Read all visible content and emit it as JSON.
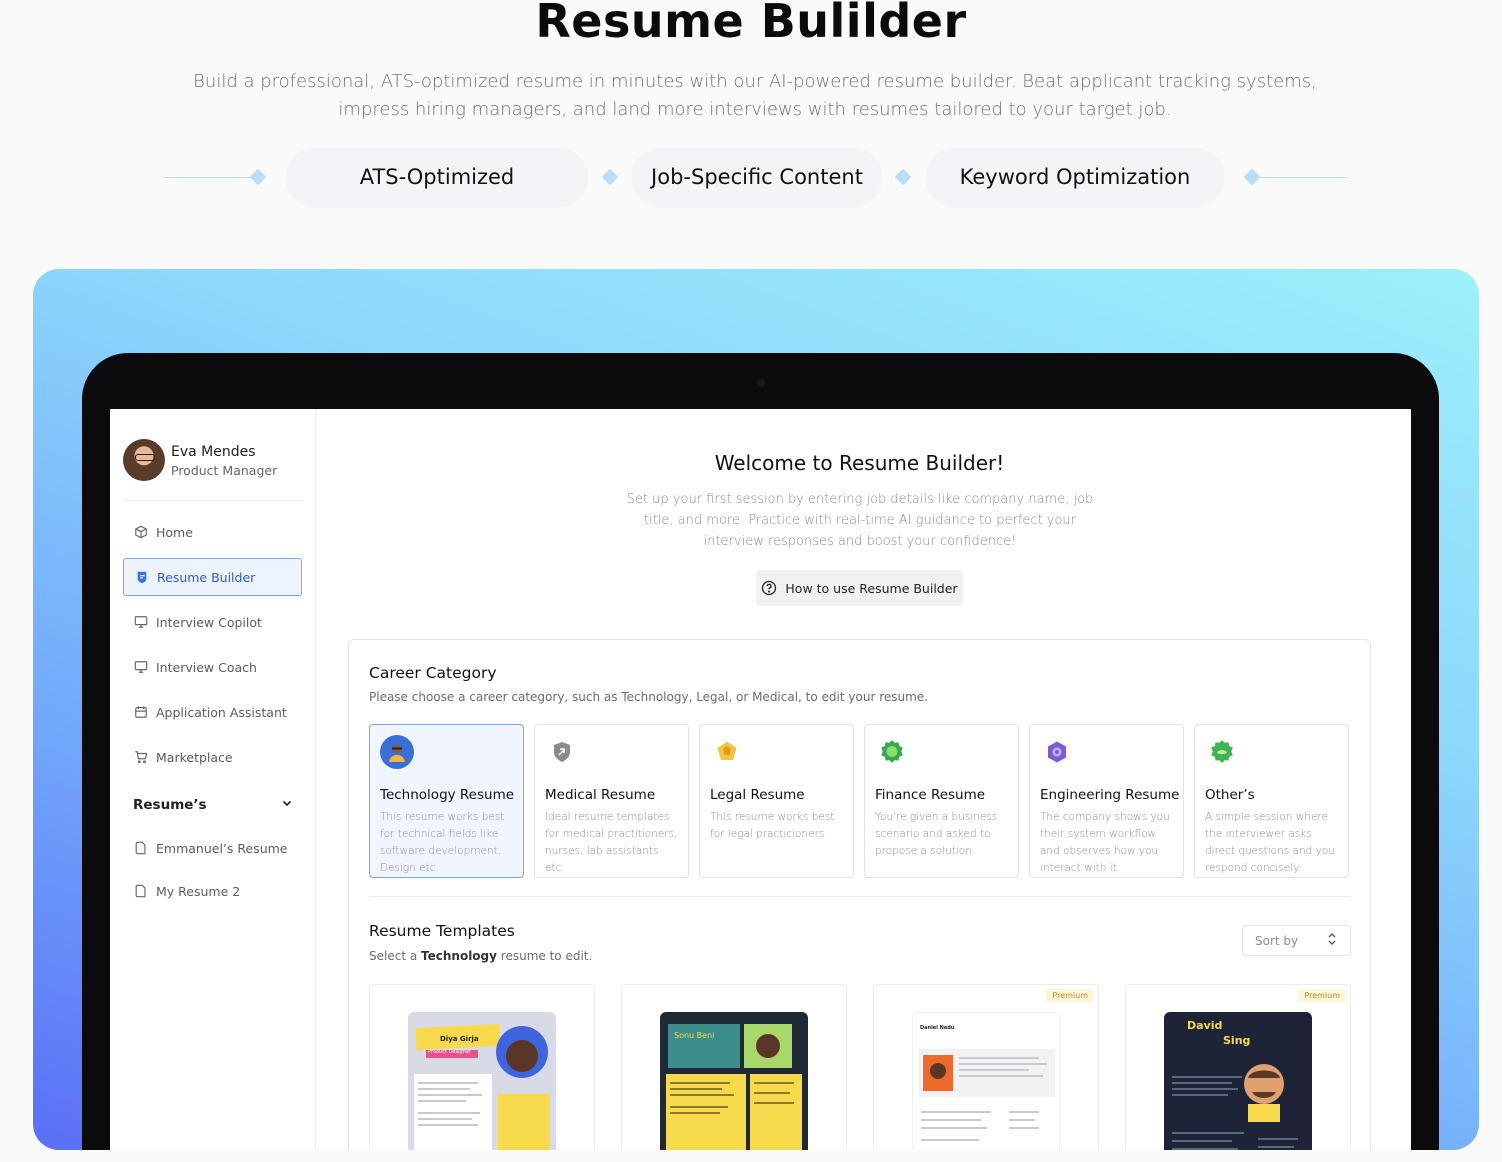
{
  "hero": {
    "title": "Resume Bulilder",
    "subtitle": "Build a professional, ATS-optimized resume in minutes with our AI-powered resume builder. Beat applicant tracking systems, impress hiring managers, and land more interviews with resumes tailored to your target job.",
    "features": [
      "ATS-Optimized",
      "Job-Specific Content",
      "Keyword Optimization"
    ]
  },
  "profile": {
    "name": "Eva Mendes",
    "role": "Product Manager"
  },
  "nav": [
    {
      "label": "Home",
      "icon": "cube-icon"
    },
    {
      "label": "Resume Builder",
      "icon": "resume-icon",
      "active": true
    },
    {
      "label": "Interview Copilot",
      "icon": "monitor-icon"
    },
    {
      "label": "Interview Coach",
      "icon": "monitor-icon"
    },
    {
      "label": "Application Assistant",
      "icon": "calendar-icon"
    },
    {
      "label": "Marketplace",
      "icon": "cart-icon"
    }
  ],
  "resumes_section": {
    "heading": "Resume’s",
    "items": [
      "Emmanuel’s Resume",
      "My Resume 2"
    ]
  },
  "welcome": {
    "title": "Welcome to Resume Builder!",
    "subtitle": "Set up your first session by entering job details like company name, job title, and more. Practice with real-time AI guidance to perfect your interview responses and boost your confidence!",
    "howto_label": "How to use Resume Builder"
  },
  "career": {
    "title": "Career Category",
    "subtitle": "Please choose a career category, such as Technology, Legal, or Medical, to edit your resume.",
    "categories": [
      {
        "name": "Technology Resume",
        "desc": "This resume works best for technical fields like software development, Design etc.",
        "active": true,
        "color": "#3b6fd8"
      },
      {
        "name": "Medical Resume",
        "desc": "Ideal resume templates for medical practitioners, nurses, lab assistants etc.",
        "color": "#7a7a82"
      },
      {
        "name": "Legal Resume",
        "desc": "This resume works best for legal practicioners.",
        "color": "#f0b429"
      },
      {
        "name": "Finance Resume",
        "desc": "You're given a business scenario and asked to propose a solution.",
        "color": "#2fa84f"
      },
      {
        "name": "Engineering Resume",
        "desc": "The company shows you their system workflow and observes how you  interact with it.",
        "color": "#7b5bd6"
      },
      {
        "name": "Other’s",
        "desc": "A simple session where the interviewer asks direct questions and you respond concisely.",
        "color": "#3fb552"
      }
    ]
  },
  "templates": {
    "title": "Resume Templates",
    "subtitle_prefix": "Select a ",
    "subtitle_bold": "Technology",
    "subtitle_suffix": " resume to edit.",
    "sort_label": "Sort by",
    "items": [
      {
        "name": "Diya Girja",
        "role": "Product Designer",
        "premium": false
      },
      {
        "name": "Sonu Beni",
        "premium": false
      },
      {
        "name": "Daniel Nedu",
        "premium": true,
        "badge": "Premium"
      },
      {
        "name": "David",
        "name2": "Sing",
        "premium": true,
        "badge": "Premium"
      }
    ]
  }
}
